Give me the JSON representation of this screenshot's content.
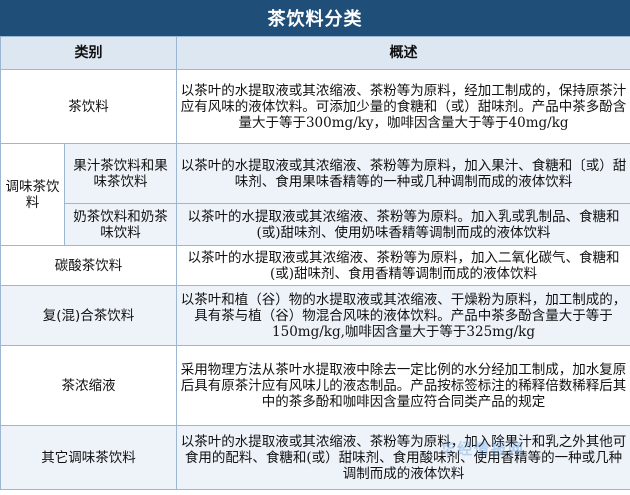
{
  "title": "茶饮料分类",
  "headers": {
    "category": "类别",
    "overview": "概述"
  },
  "rows": {
    "tea": {
      "name": "茶饮料",
      "desc": "以茶叶的水提取液或其浓缩液、茶粉等为原料，经加工制成的，保持原茶汁应有风味的液体饮料。可添加少量的食糖和（或）甜味剂。产品中茶多酚含量大于等于300mg/ky，咖啡因含量大于等于40mg/kg"
    },
    "flavored": {
      "name": "调味茶饮料",
      "juice": {
        "name": "果汁茶饮料和果味茶饮料",
        "desc": "以茶叶的水提取液或其浓缩液、茶粉等为原料，加入果汁、食糖和〔或）甜味剂、食用果味香精等的一种或几种调制而成的液体饮料"
      },
      "milk": {
        "name": "奶茶饮料和奶茶味饮料",
        "desc": "以茶叶的水提取液或其浓缩液、茶粉等为原料。加入乳或乳制品、食糖和(或)甜味剂、使用奶味香精等调制而成的液体饮料"
      }
    },
    "carbonated": {
      "name": "碳酸茶饮料",
      "desc": "以茶叶的水提取液或其浓缩液、茶粉等为原料，加入二氧化碳气、食糖和(或)甜味剂、食用香精等调制而成的液体饮料"
    },
    "compound": {
      "name": "复(混)合茶饮料",
      "desc": "以茶叶和植（谷）物的水提取液或其浓缩液、干燥粉为原料，加工制成的，具有茶与植（谷）物混合风味的液体饮料。产品中茶多酚含量大于等于150mg/kg,咖啡因含量大于等于325mg/kg"
    },
    "concentrate": {
      "name": "茶浓缩液",
      "desc": "采用物理方法从茶叶水提取液中除去一定比例的水分经加工制成，加水复原后具有原茶汁应有风味儿的液态制品。产品按标签标注的稀释倍数稀释后其中的茶多酚和咖啡因含量应符合同类产品的规定"
    },
    "other": {
      "name": "其它调味茶饮料",
      "desc": "以茶叶的水提取液或其浓缩液、茶粉等为原料，加入除果汁和乳之外其他可食用的配料、食糖和(或）甜味剂、食用酸味剂、使用香精等的一种或几种调制而成的液体饮料"
    }
  },
  "watermark": "华经情报网",
  "colors": {
    "title_bg": "#1f4e79",
    "header_bg": "#dde7f2",
    "border": "#9bb7d1",
    "alt_row": "#eef3f9"
  }
}
